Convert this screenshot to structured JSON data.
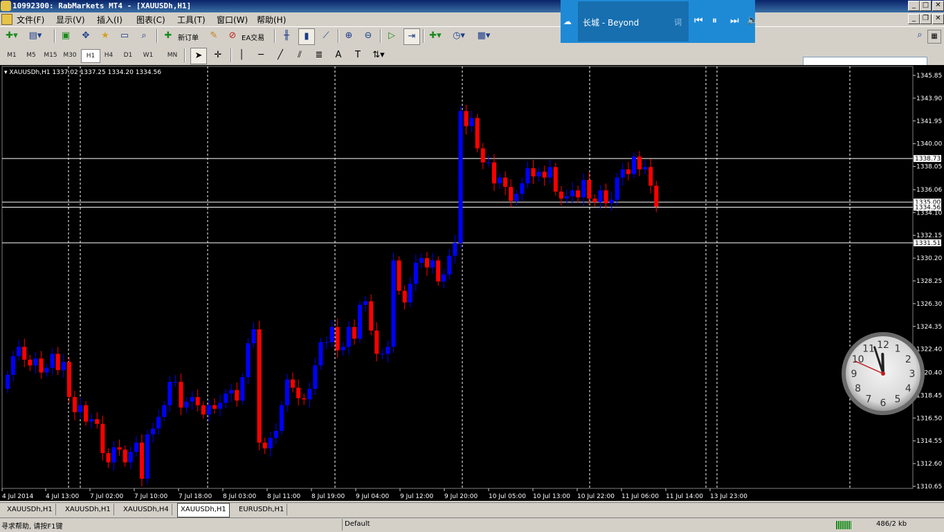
{
  "window": {
    "title": "10992300: RabMarkets MT4 - [XAUUSDh,H1]"
  },
  "menu": [
    "文件(F)",
    "显示(V)",
    "插入(I)",
    "图表(C)",
    "工具(T)",
    "窗口(W)",
    "帮助(H)"
  ],
  "toolbar": {
    "new_order": "新订单",
    "ea_trading": "EA交易"
  },
  "timeframes": [
    "M1",
    "M5",
    "M15",
    "M30",
    "H1",
    "H4",
    "D1",
    "W1",
    "MN"
  ],
  "active_timeframe": "H1",
  "player": {
    "track": "长城 - Beyond",
    "lyrics_glyph": "词"
  },
  "chart": {
    "header": "XAUUSDh,H1  1337.02 1337.25 1334.20 1334.56",
    "colors": {
      "bull": "#0000ff",
      "bear": "#ff0000",
      "bg": "#000000",
      "grid": "#ffffff"
    }
  },
  "chart_data": {
    "type": "candlestick",
    "symbol": "XAUUSDh",
    "timeframe": "H1",
    "ylim": [
      1310.65,
      1345.85
    ],
    "y_ticks": [
      1345.85,
      1343.9,
      1341.95,
      1340.0,
      1338.05,
      1336.06,
      1334.1,
      1332.15,
      1330.2,
      1328.25,
      1326.3,
      1324.35,
      1322.4,
      1320.4,
      1318.45,
      1316.5,
      1314.55,
      1312.6,
      1310.65
    ],
    "x_ticks": [
      "4 Jul 2014",
      "4 Jul 13:00",
      "7 Jul 02:00",
      "7 Jul 10:00",
      "7 Jul 18:00",
      "8 Jul 03:00",
      "8 Jul 11:00",
      "8 Jul 19:00",
      "9 Jul 04:00",
      "9 Jul 12:00",
      "9 Jul 20:00",
      "10 Jul 05:00",
      "10 Jul 13:00",
      "10 Jul 22:00",
      "11 Jul 06:00",
      "11 Jul 14:00",
      "13 Jul 23:00"
    ],
    "horizontal_lines": [
      {
        "price": 1338.73,
        "label": "1338.73"
      },
      {
        "price": 1335.0,
        "label": "1335.00"
      },
      {
        "price": 1334.56,
        "label": "1334.56"
      },
      {
        "price": 1331.51,
        "label": "1331.51"
      }
    ],
    "closes": [
      1320.2,
      1321.8,
      1322.6,
      1321.5,
      1321.0,
      1321.6,
      1320.4,
      1320.8,
      1322.0,
      1320.6,
      1321.3,
      1318.3,
      1317.0,
      1317.6,
      1316.2,
      1316.4,
      1316.0,
      1313.5,
      1312.7,
      1314.0,
      1313.8,
      1312.7,
      1313.6,
      1314.4,
      1311.3,
      1315.1,
      1315.6,
      1316.6,
      1317.6,
      1319.6,
      1319.6,
      1317.4,
      1317.9,
      1318.3,
      1317.6,
      1316.8,
      1317.6,
      1317.3,
      1317.8,
      1318.6,
      1318.9,
      1318.0,
      1320.0,
      1322.9,
      1324.1,
      1314.4,
      1313.9,
      1314.8,
      1315.4,
      1317.6,
      1319.8,
      1319.1,
      1318.2,
      1318.1,
      1319.0,
      1321.0,
      1323.0,
      1323.0,
      1324.3,
      1322.3,
      1322.6,
      1324.3,
      1323.3,
      1326.2,
      1326.5,
      1324.0,
      1322.0,
      1322.0,
      1322.6,
      1330.0,
      1327.4,
      1326.4,
      1328.0,
      1329.8,
      1330.2,
      1329.4,
      1330.0,
      1328.2,
      1328.8,
      1330.4,
      1331.5,
      1342.8,
      1341.5,
      1342.2,
      1339.6,
      1338.4,
      1338.4,
      1336.6,
      1337.1,
      1336.3,
      1335.1,
      1335.7,
      1336.6,
      1337.9,
      1337.2,
      1337.6,
      1337.1,
      1338.0,
      1335.9,
      1335.3,
      1335.5,
      1336.0,
      1335.4,
      1336.9,
      1335.3,
      1335.0,
      1336.0,
      1334.9,
      1335.2,
      1337.1,
      1337.8,
      1337.4,
      1338.9,
      1337.8,
      1338.0,
      1336.4,
      1334.6
    ]
  },
  "tabs": [
    "XAUUSDh,H1",
    "XAUUSDh,H1",
    "XAUUSDh,H4",
    "XAUUSDh,H1",
    "EURUSDh,H1"
  ],
  "active_tab": 3,
  "status": {
    "help": "寻求帮助, 请按F1键",
    "profile": "Default",
    "traffic": "486/2 kb"
  },
  "clock": {
    "numerals": [
      "12",
      "1",
      "2",
      "3",
      "4",
      "5",
      "6",
      "7",
      "8",
      "9",
      "10",
      "11"
    ],
    "hour": 11,
    "minute": 57,
    "second": 49
  }
}
